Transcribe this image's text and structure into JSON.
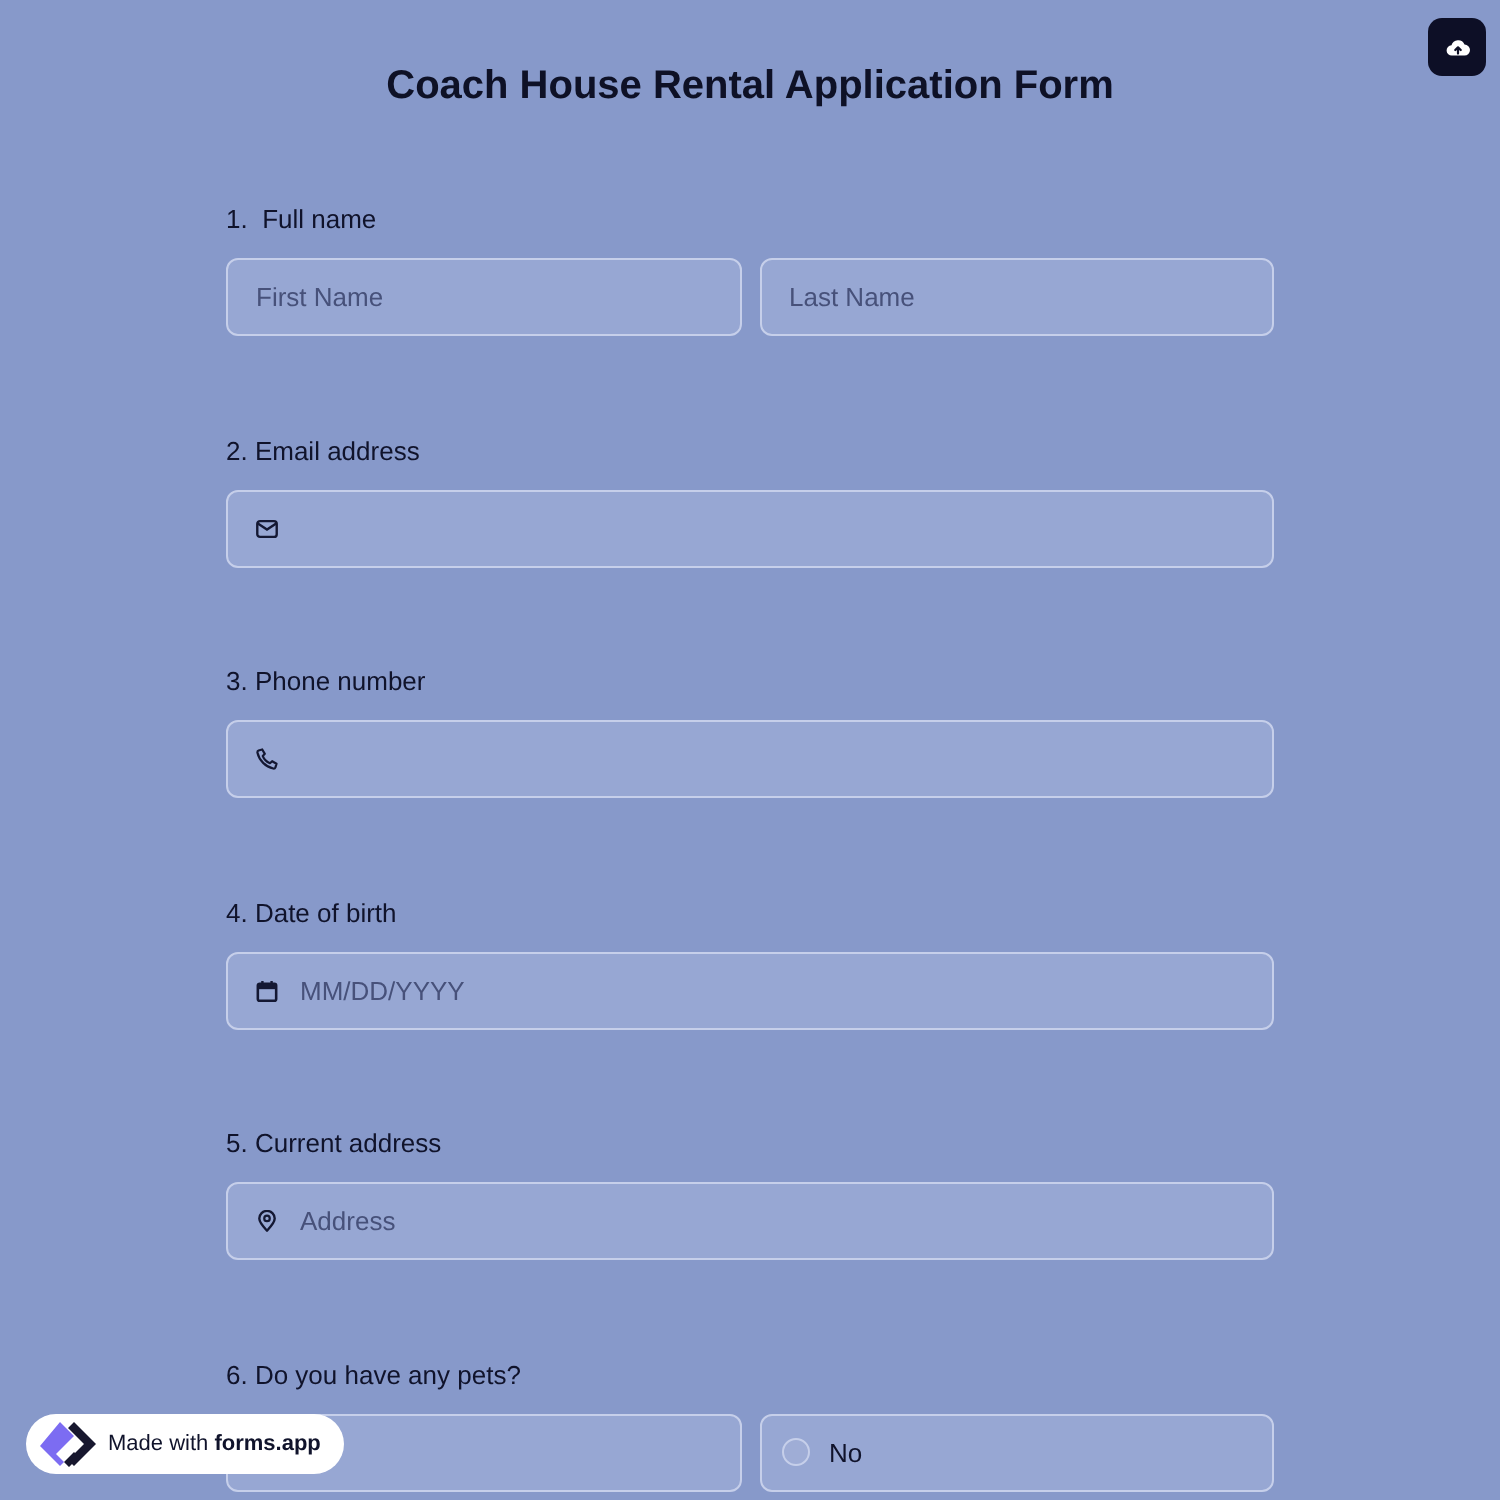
{
  "title": "Coach House Rental Application Form",
  "questions": [
    {
      "label": "1.  Full name",
      "kind": "pair",
      "fields": [
        {
          "placeholder": "First Name"
        },
        {
          "placeholder": "Last Name"
        }
      ]
    },
    {
      "label": "2. Email address",
      "kind": "email"
    },
    {
      "label": "3. Phone number",
      "kind": "phone"
    },
    {
      "label": "4. Date of birth",
      "kind": "date",
      "placeholder": "MM/DD/YYYY"
    },
    {
      "label": "5. Current address",
      "kind": "address",
      "placeholder": "Address"
    },
    {
      "label": "6. Do you have any pets?",
      "kind": "choice",
      "options": [
        {
          "selected": false
        },
        {
          "label": "No",
          "selected": false
        }
      ]
    }
  ],
  "badge": {
    "text": "Made with **forms.app**"
  }
}
